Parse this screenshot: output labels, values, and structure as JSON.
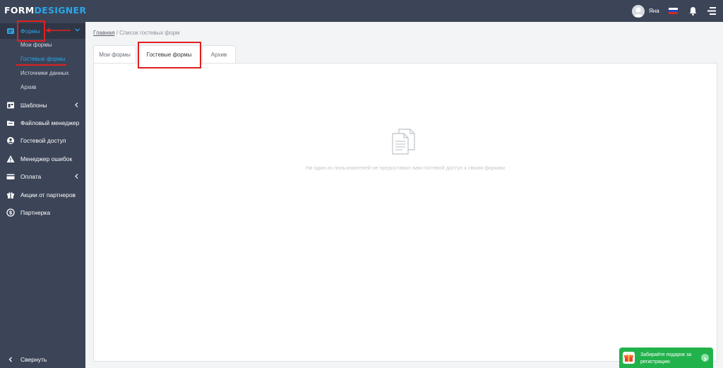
{
  "header": {
    "logo_part1": "FORM",
    "logo_part2": "DESIGNER",
    "username": "Яна"
  },
  "sidebar": {
    "items": [
      {
        "label": "Формы",
        "icon": "forms-icon"
      },
      {
        "label": "Шаблоны",
        "icon": "templates-icon"
      },
      {
        "label": "Файловый менеджер",
        "icon": "file-manager-icon"
      },
      {
        "label": "Гостевой доступ",
        "icon": "guest-access-icon"
      },
      {
        "label": "Менеджер ошибок",
        "icon": "warning-icon"
      },
      {
        "label": "Оплата",
        "icon": "payment-icon"
      },
      {
        "label": "Акции от партнеров",
        "icon": "gift-icon"
      },
      {
        "label": "Партнерка",
        "icon": "dollar-icon"
      }
    ],
    "subitems": [
      "Мои формы",
      "Гостевые формы",
      "Источники данных",
      "Архив"
    ],
    "collapse_label": "Свернуть"
  },
  "breadcrumb": {
    "home": "Главная",
    "separator": "/",
    "current": "Список гостевых форм"
  },
  "tabs": [
    "Мои формы",
    "Гостевые формы",
    "Архив"
  ],
  "empty_message": "Ни один из пользователей не предоставил вам гостевой доступ к своим формам",
  "promo": {
    "text": "Забирайте подарок за регистрацию"
  },
  "colors": {
    "accent": "#2aa6e8",
    "sidebar_bg": "#3c4457",
    "annotation": "#e02020",
    "promo_bg": "#22b24c"
  }
}
